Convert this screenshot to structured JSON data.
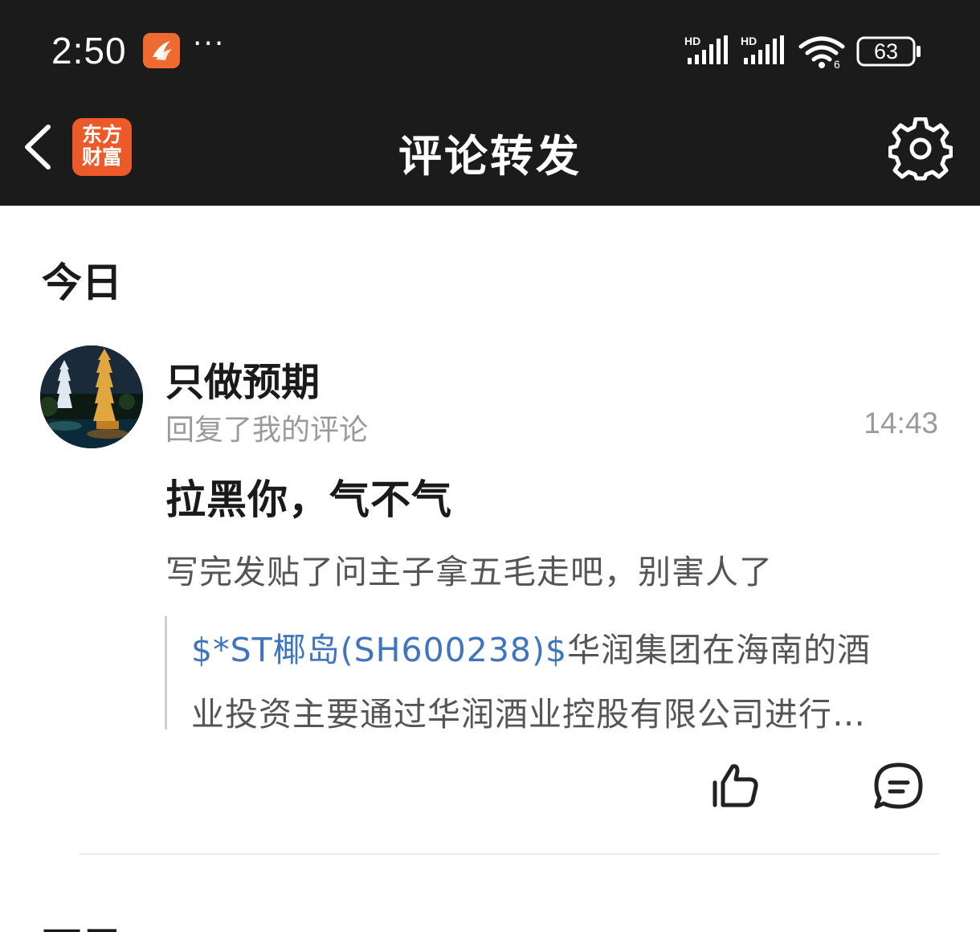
{
  "status_bar": {
    "time": "2:50",
    "more": "···",
    "signal_label": "HD",
    "battery": "63",
    "wifi_label": "6"
  },
  "nav": {
    "logo_line1": "东方",
    "logo_line2": "财富",
    "title": "评论转发"
  },
  "sections": [
    {
      "title": "今日",
      "items": [
        {
          "username": "只做预期",
          "action": "回复了我的评论",
          "time": "14:43",
          "reply": "拉黑你，气不气",
          "original_comment": "写完发贴了问主子拿五毛走吧，别害人了",
          "quote_stock": "$*ST椰岛(SH600238)$",
          "quote_line1_rest": "华润集团在海南的酒",
          "quote_line2": "业投资主要通过华润酒业控股有限公司进行…"
        }
      ]
    },
    {
      "title": "更早"
    }
  ],
  "colors": {
    "header_bg": "#1b1b1b",
    "brand_orange": "#ec5a2a",
    "link_blue": "#3f74bf",
    "secondary_text": "#9a9a9a"
  }
}
